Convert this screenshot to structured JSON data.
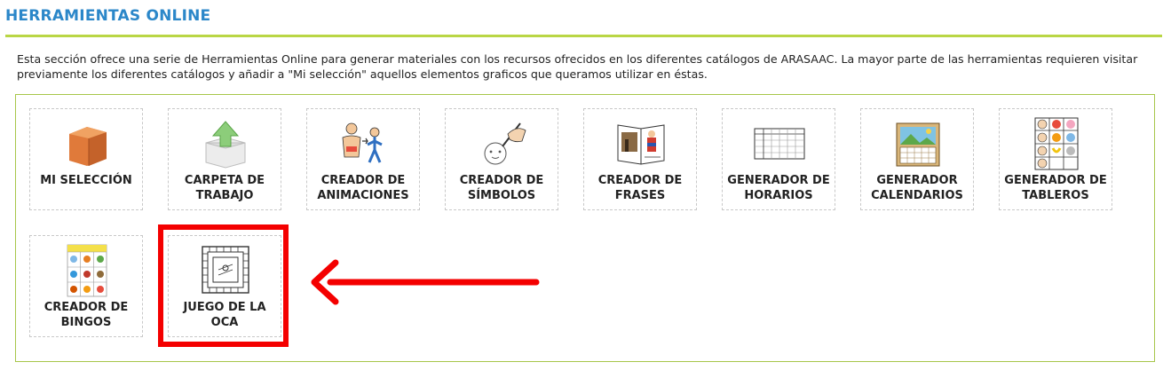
{
  "page": {
    "title": "HERRAMIENTAS ONLINE",
    "intro": "Esta sección ofrece una serie de Herramientas Online para generar materiales con los recursos ofrecidos en los diferentes catálogos de ARASAAC. La mayor parte de las herramientas requieren visitar previamente los diferentes catálogos y añadir a \"Mi selección\" aquellos elementos graficos que queramos utilizar en éstas."
  },
  "tools": [
    {
      "label": "MI SELECCIÓN",
      "icon": "box-icon"
    },
    {
      "label": "CARPETA DE TRABAJO",
      "icon": "upload-box-icon"
    },
    {
      "label": "CREADOR DE ANIMACIONES",
      "icon": "animation-people-icon"
    },
    {
      "label": "CREADOR DE SÍMBOLOS",
      "icon": "drawing-hand-icon"
    },
    {
      "label": "CREADOR DE FRASES",
      "icon": "book-icon"
    },
    {
      "label": "GENERADOR DE HORARIOS",
      "icon": "schedule-grid-icon"
    },
    {
      "label": "GENERADOR CALENDARIOS",
      "icon": "calendar-icon"
    },
    {
      "label": "GENERADOR DE TABLEROS",
      "icon": "board-grid-icon"
    },
    {
      "label": "CREADOR DE BINGOS",
      "icon": "bingo-card-icon"
    },
    {
      "label": "JUEGO DE LA OCA",
      "icon": "goose-game-board-icon"
    }
  ],
  "annotation": {
    "highlight_color": "#f40000",
    "points_to": "JUEGO DE LA OCA"
  },
  "colors": {
    "title": "#2b87c9",
    "rule": "#b9d645",
    "panel_border": "#a7c64a"
  }
}
